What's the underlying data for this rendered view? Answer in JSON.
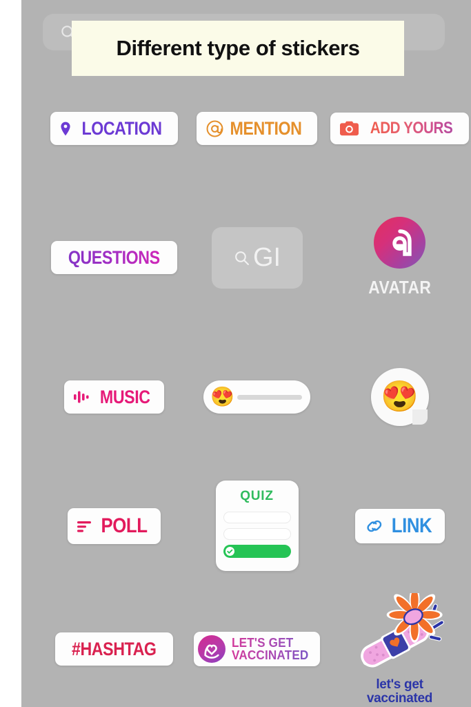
{
  "page": {
    "title_overlay": "Different type of stickers",
    "background_color": "#b3b3b3",
    "overlay_color": "#fbfbe8"
  },
  "search": {
    "icon": "search-icon",
    "value": "",
    "placeholder": ""
  },
  "gif_box": {
    "icon": "search-icon",
    "text": "GI"
  },
  "stickers": [
    {
      "id": "location",
      "label": "LOCATION",
      "icon": "location-pin-icon",
      "color": "#6c3ad4"
    },
    {
      "id": "mention",
      "label": "MENTION",
      "icon": "at-sign-icon",
      "color": "#e5902c"
    },
    {
      "id": "add-yours",
      "label": "ADD YOURS",
      "icon": "camera-icon",
      "color": "#ef5c4c"
    },
    {
      "id": "questions",
      "label": "QUESTIONS",
      "icon": "",
      "color": "#a12ec4"
    },
    {
      "id": "avatar",
      "label": "AVATAR",
      "icon": "avatar-face-icon",
      "color": "#d6307a"
    },
    {
      "id": "music",
      "label": "MUSIC",
      "icon": "music-waveform-icon",
      "color": "#e61a78"
    },
    {
      "id": "emoji-slider",
      "label": "",
      "icon": "heart-eyes-emoji",
      "color": "#d8d8d8"
    },
    {
      "id": "emoji-reaction",
      "label": "",
      "icon": "heart-eyes-emoji",
      "color": "#fafafa"
    },
    {
      "id": "poll",
      "label": "POLL",
      "icon": "poll-bars-icon",
      "color": "#e21a5c"
    },
    {
      "id": "quiz",
      "label": "QUIZ",
      "icon": "check-icon",
      "color": "#30bb5e"
    },
    {
      "id": "link",
      "label": "LINK",
      "icon": "chain-link-icon",
      "color": "#2f8fe0"
    },
    {
      "id": "hashtag",
      "label": "#HASHTAG",
      "icon": "",
      "color": "#d9214f"
    },
    {
      "id": "lets-get-vaccinated",
      "label_line1": "LET'S GET",
      "label_line2": "VACCINATED",
      "icon": "heart-globe-icon",
      "color": "#a44bb6"
    },
    {
      "id": "bandage-vaccinated",
      "label_line1": "let's get",
      "label_line2": "vaccinated",
      "icon": "bandage-flower-icon",
      "color": "#2b35a8"
    }
  ],
  "emoji": {
    "heart_eyes": "😍"
  }
}
